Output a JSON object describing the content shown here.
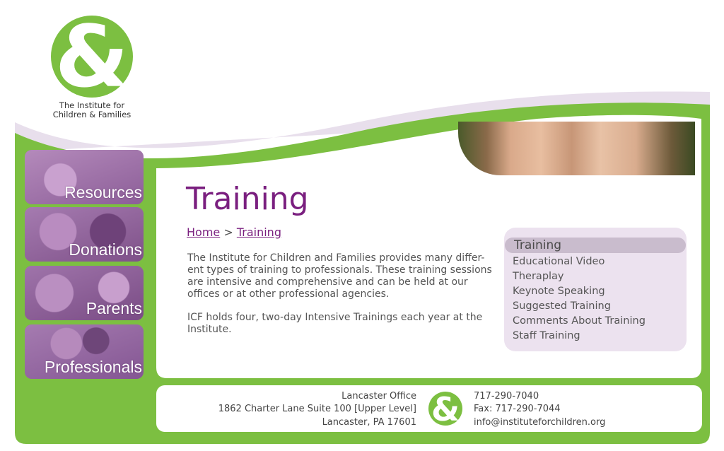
{
  "org": {
    "logo_glyph": "&",
    "name_line1": "The Institute for",
    "name_line2": "Children & Families"
  },
  "nav": [
    {
      "label": "Resources"
    },
    {
      "label": "Donations"
    },
    {
      "label": "Parents"
    },
    {
      "label": "Professionals"
    }
  ],
  "page": {
    "title": "Training",
    "breadcrumb": {
      "home": "Home",
      "separator": ">",
      "current": "Training"
    },
    "paragraphs": [
      {
        "lines": [
          "The Institute for Children and Families provides many differ-",
          "ent types of training to professionals. These training sessions",
          "are intensive and comprehensive and can be held at our",
          "offices or at other professional agencies."
        ]
      },
      {
        "lines": [
          "ICF holds four, two-day Intensive Trainings each year at the Institute."
        ]
      }
    ]
  },
  "submenu": {
    "items": [
      {
        "label": "Training",
        "active": true
      },
      {
        "label": "Educational Video"
      },
      {
        "label": "Theraplay"
      },
      {
        "label": "Keynote Speaking"
      },
      {
        "label": "Suggested Training"
      },
      {
        "label": "Comments About Training"
      },
      {
        "label": "Staff Training"
      }
    ]
  },
  "footer": {
    "office": "Lancaster Office",
    "address1": "1862 Charter Lane Suite 100 [Upper Level]",
    "address2": "Lancaster, PA 17601",
    "logo_glyph": "&",
    "phone": "717-290-7040",
    "fax": "Fax: 717-290-7044",
    "email": "info@instituteforchildren.org"
  },
  "colors": {
    "green": "#7cbf41",
    "purple": "#7a1f7f",
    "lavender": "#ece2ef",
    "nav_purple": "#9a6aa6"
  }
}
